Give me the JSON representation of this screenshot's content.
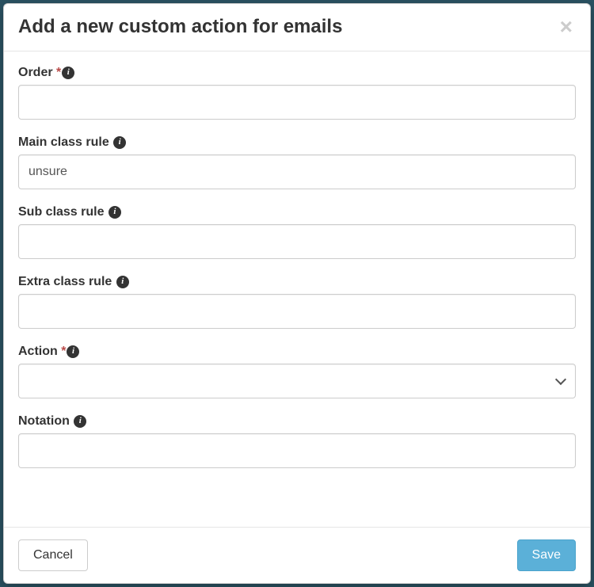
{
  "modal": {
    "title": "Add a new custom action for emails",
    "close_symbol": "×"
  },
  "fields": {
    "order": {
      "label": "Order",
      "required": true,
      "value": ""
    },
    "main_class_rule": {
      "label": "Main class rule",
      "required": false,
      "value": "unsure"
    },
    "sub_class_rule": {
      "label": "Sub class rule",
      "required": false,
      "value": ""
    },
    "extra_class_rule": {
      "label": "Extra class rule",
      "required": false,
      "value": ""
    },
    "action": {
      "label": "Action",
      "required": true,
      "value": ""
    },
    "notation": {
      "label": "Notation",
      "required": false,
      "value": ""
    }
  },
  "footer": {
    "cancel": "Cancel",
    "save": "Save"
  },
  "icons": {
    "info_glyph": "i"
  }
}
